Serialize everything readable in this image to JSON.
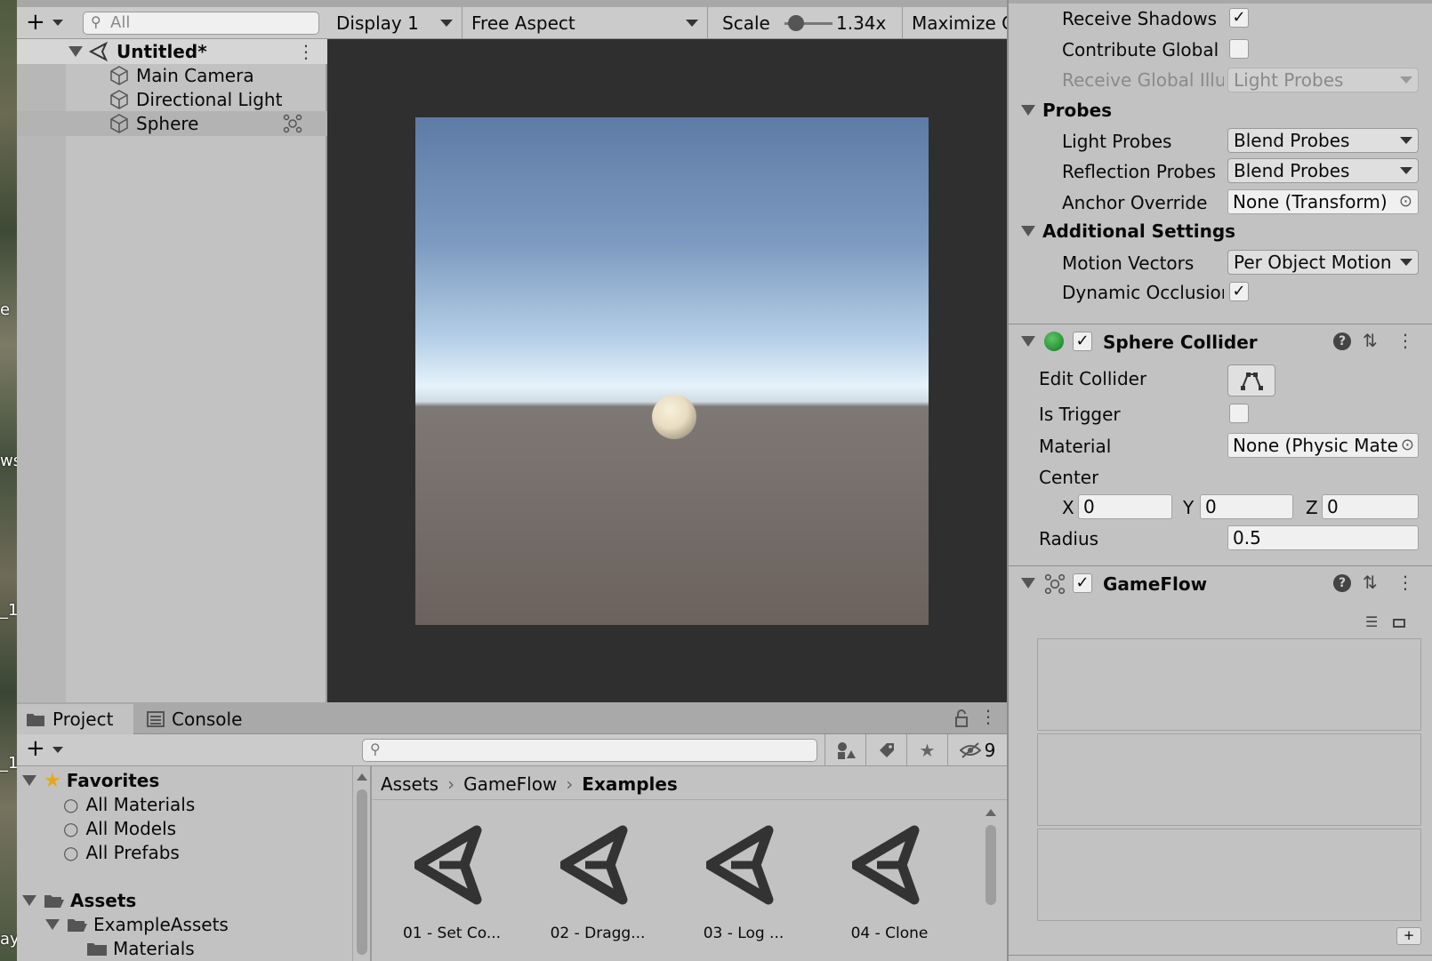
{
  "hierarchy": {
    "search_placeholder": "All",
    "scene": "Untitled*",
    "items": [
      "Main Camera",
      "Directional Light",
      "Sphere"
    ]
  },
  "game_view": {
    "display": "Display 1",
    "aspect": "Free Aspect",
    "scale_label": "Scale",
    "scale_value": "1.34x",
    "maximize": "Maximize C"
  },
  "inspector": {
    "receive_shadows": "Receive Shadows",
    "contribute_gi": "Contribute Global Il",
    "receive_gi": "Receive Global Illu",
    "receive_gi_value": "Light Probes",
    "probes_header": "Probes",
    "light_probes": "Light Probes",
    "light_probes_value": "Blend Probes",
    "reflection_probes": "Reflection Probes",
    "reflection_probes_value": "Blend Probes",
    "anchor_override": "Anchor Override",
    "anchor_override_value": "None (Transform)",
    "additional_header": "Additional Settings",
    "motion_vectors": "Motion Vectors",
    "motion_vectors_value": "Per Object Motion",
    "dynamic_occlusion": "Dynamic Occlusior",
    "sphere_collider": "Sphere Collider",
    "edit_collider": "Edit Collider",
    "is_trigger": "Is Trigger",
    "material": "Material",
    "material_value": "None (Physic Mate",
    "center": "Center",
    "x_label": "X",
    "x_value": "0",
    "y_label": "Y",
    "y_value": "0",
    "z_label": "Z",
    "z_value": "0",
    "radius": "Radius",
    "radius_value": "0.5",
    "gameflow": "GameFlow",
    "plus": "+"
  },
  "project": {
    "tab_project": "Project",
    "tab_console": "Console",
    "hidden_count": "9",
    "favorites": "Favorites",
    "fav_items": [
      "All Materials",
      "All Models",
      "All Prefabs"
    ],
    "assets": "Assets",
    "example_assets": "ExampleAssets",
    "materials": "Materials",
    "breadcrumb": [
      "Assets",
      "GameFlow",
      "Examples"
    ],
    "assets_grid": [
      "01 - Set Co...",
      "02 - Dragg...",
      "03 - Log ...",
      "04 - Clone"
    ]
  },
  "desktop_labels": [
    "e",
    "ws",
    "_1",
    "_1",
    "ay"
  ],
  "colors": {
    "accent_green": "#2e9a3a",
    "star": "#e6a817",
    "sky_top": "#5e7ea8",
    "ground": "#6b625e"
  }
}
